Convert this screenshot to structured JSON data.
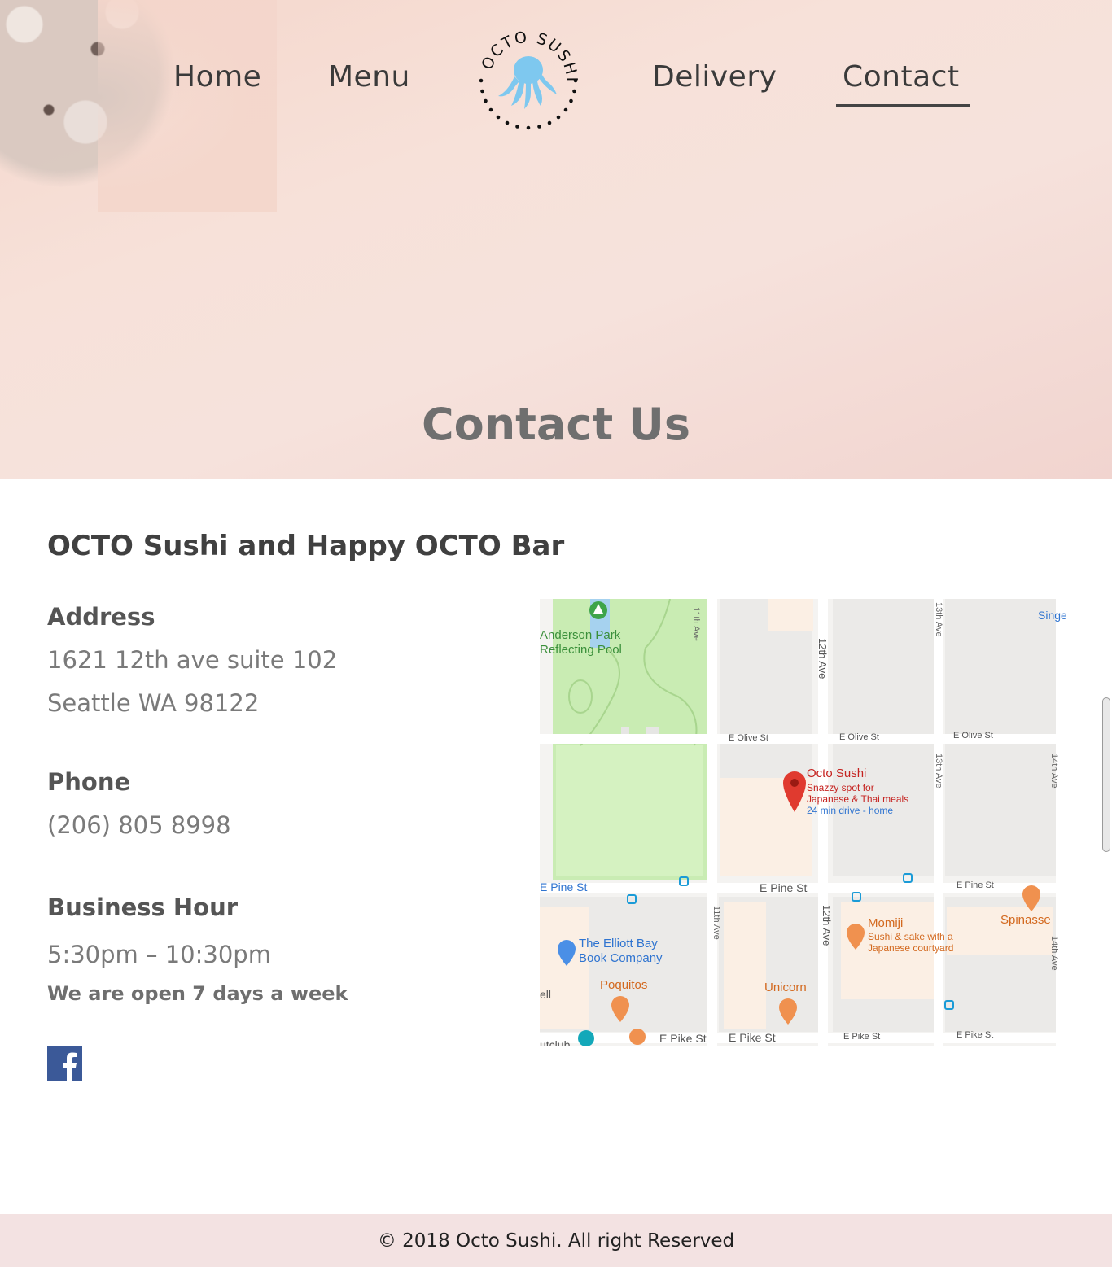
{
  "nav": {
    "home": "Home",
    "menu": "Menu",
    "delivery": "Delivery",
    "contact": "Contact",
    "active": "contact",
    "logo_text": "OCTO SUSHI"
  },
  "hero": {
    "title": "Contact Us"
  },
  "business": {
    "name": "OCTO Sushi and Happy OCTO Bar",
    "address_label": "Address",
    "address_line1": "1621 12th ave suite 102",
    "address_line2": "Seattle WA 98122",
    "phone_label": "Phone",
    "phone": "(206) 805 8998",
    "hours_label": "Business Hour",
    "hours": "5:30pm – 10:30pm",
    "hours_note": "We are open 7 days a week"
  },
  "social": {
    "facebook_icon": "facebook-icon",
    "facebook_color": "#3b5998"
  },
  "map": {
    "park_name_1": "Anderson Park",
    "park_name_2": "Reflecting Pool",
    "pin_title": "Octo Sushi",
    "pin_desc_1": "Snazzy spot for",
    "pin_desc_2": "Japanese & Thai meals",
    "pin_drive": "24 min drive - home",
    "streets": {
      "e_olive_1": "E Olive St",
      "e_olive_2": "E Olive St",
      "e_olive_3": "E Olive St",
      "e_pine_1": "E Pine St",
      "e_pine_2": "E Pine St",
      "e_pine_3": "E Pine St",
      "e_pike_1": "E Pike St",
      "e_pike_2": "E Pike St",
      "e_pike_3": "E Pike St",
      "e_pike_4": "E Pike St",
      "ave_11_top": "11th Ave",
      "ave_11_bottom": "11th Ave",
      "ave_12_top": "12th Ave",
      "ave_12_bottom": "12th Ave",
      "ave_13_top": "13th Ave",
      "ave_13_mid": "13th Ave",
      "ave_14_top": "14th Ave",
      "ave_14_bottom": "14th Ave"
    },
    "places": {
      "momiji": "Momiji",
      "momiji_desc_1": "Sushi & sake with a",
      "momiji_desc_2": "Japanese courtyard",
      "spinasse": "Spinasse",
      "elliott_1": "The Elliott Bay",
      "elliott_2": "Book Company",
      "poquitos": "Poquitos",
      "unicorn": "Unicorn",
      "sing": "Singe",
      "club": "utclub",
      "ell": "ell"
    },
    "colors": {
      "park": "#c8ecb0",
      "pin": "#e03a2f",
      "poi_food": "#f0914f",
      "transit": "#1a9bd7"
    }
  },
  "footer": {
    "copyright": "© 2018 Octo Sushi. All right Reserved"
  }
}
